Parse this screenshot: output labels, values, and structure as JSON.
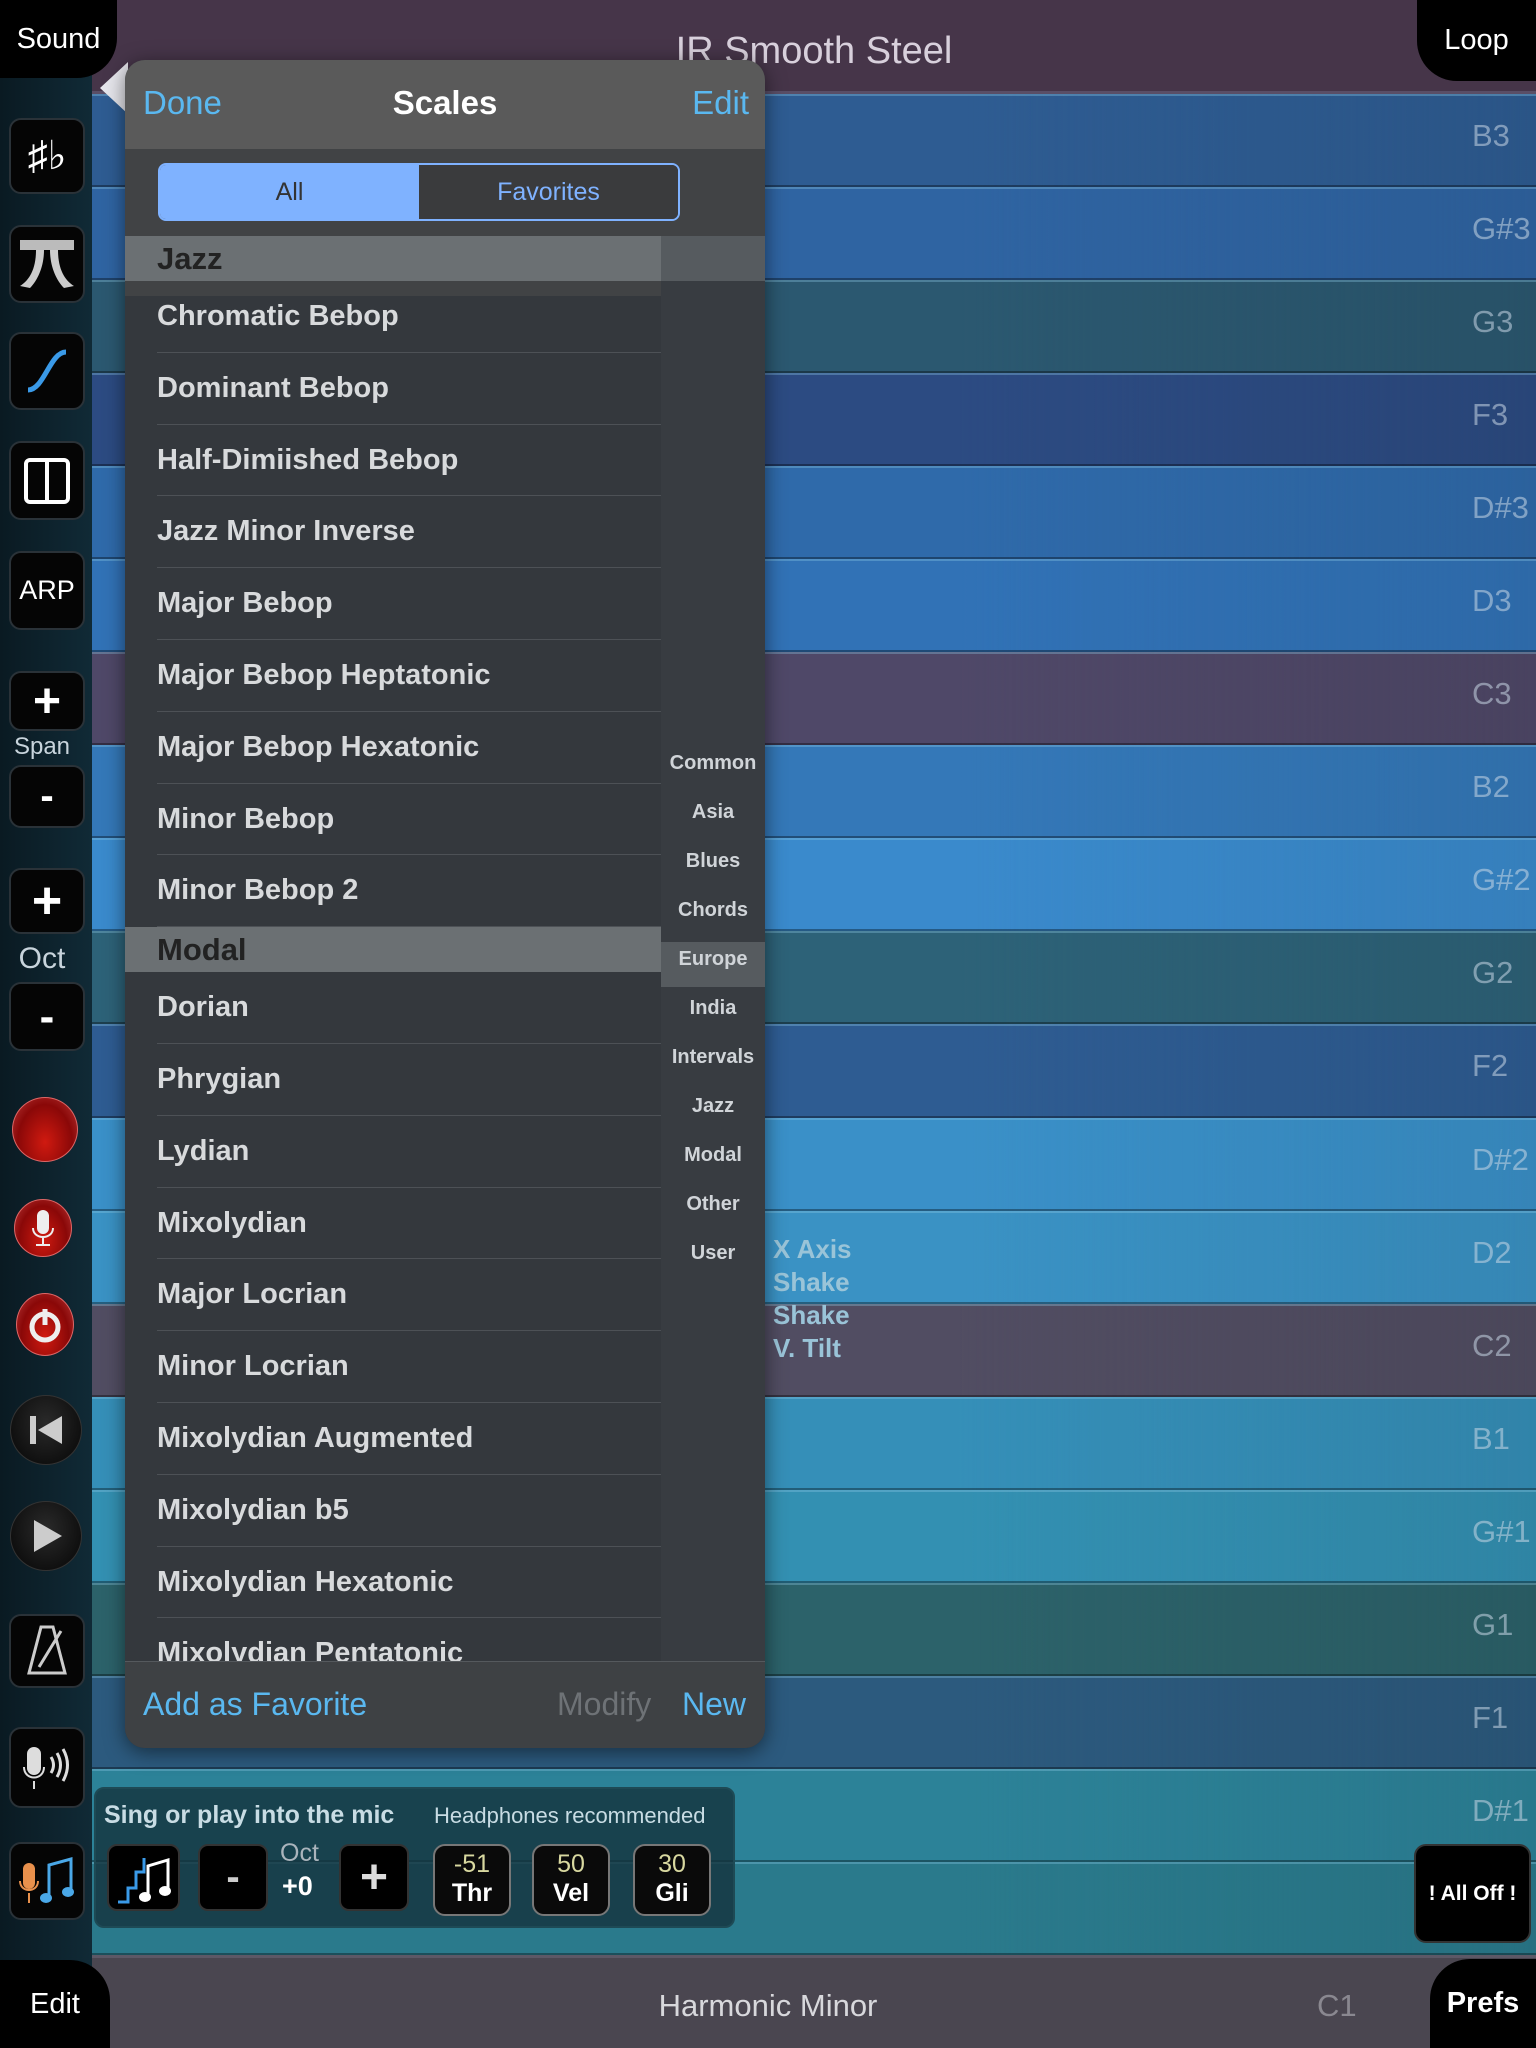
{
  "header": {
    "title": "IR Smooth Steel",
    "sound_tab": "Sound",
    "loop_tab": "Loop"
  },
  "footer": {
    "scale_name": "Harmonic Minor",
    "root_note": "C1",
    "edit_tab": "Edit",
    "prefs_tab": "Prefs"
  },
  "strips": [
    {
      "note": "B3",
      "color": "#2e5c92"
    },
    {
      "note": "G#3",
      "color": "#2f64a2"
    },
    {
      "note": "G3",
      "color": "#2b5870"
    },
    {
      "note": "F3",
      "color": "#2c4b82"
    },
    {
      "note": "D#3",
      "color": "#2f6aaa"
    },
    {
      "note": "D3",
      "color": "#3172b6"
    },
    {
      "note": "C3",
      "color": "#4f4868"
    },
    {
      "note": "B2",
      "color": "#3478b8"
    },
    {
      "note": "G#2",
      "color": "#3a8acc"
    },
    {
      "note": "G2",
      "color": "#2d6278"
    },
    {
      "note": "F2",
      "color": "#2e5c92"
    },
    {
      "note": "D#2",
      "color": "#3a90c8"
    },
    {
      "note": "D2",
      "color": "#3a92c4"
    },
    {
      "note": "C2",
      "color": "#514d62"
    },
    {
      "note": "B1",
      "color": "#358fb8"
    },
    {
      "note": "G#1",
      "color": "#3390b2"
    },
    {
      "note": "G1",
      "color": "#2c626a"
    },
    {
      "note": "F1",
      "color": "#2c5a7e"
    },
    {
      "note": "D#1",
      "color": "#2c8298"
    },
    {
      "note": "",
      "color": "#2a7a8c"
    }
  ],
  "axis_labels": [
    "X Axis",
    "Shake",
    "Shake",
    "V. Tilt"
  ],
  "sidebar": {
    "arp": "ARP",
    "span": "Span",
    "oct": "Oct",
    "plus": "+",
    "minus": "-",
    "sharp_flat": "♯♭"
  },
  "popup": {
    "done": "Done",
    "title": "Scales",
    "edit": "Edit",
    "segments": [
      "All",
      "Favorites"
    ],
    "sections": [
      {
        "name": "Jazz",
        "items": [
          "Chromatic Bebop",
          "Dominant Bebop",
          "Half-Dimiished Bebop",
          "Jazz Minor Inverse",
          "Major Bebop",
          "Major Bebop Heptatonic",
          "Major Bebop Hexatonic",
          "Minor Bebop",
          "Minor Bebop 2"
        ]
      },
      {
        "name": "Modal",
        "items": [
          "Dorian",
          "Phrygian",
          "Lydian",
          "Mixolydian",
          "Major Locrian",
          "Minor Locrian",
          "Mixolydian Augmented",
          "Mixolydian b5",
          "Mixolydian Hexatonic",
          "Mixolydian Pentatonic"
        ]
      }
    ],
    "index": [
      "Common",
      "Asia",
      "Blues",
      "Chords",
      "Europe",
      "India",
      "Intervals",
      "Jazz",
      "Modal",
      "Other",
      "User"
    ],
    "add_favorite": "Add as Favorite",
    "modify": "Modify",
    "new": "New"
  },
  "mic_panel": {
    "title": "Sing or play into the mic",
    "hint": "Headphones recommended",
    "oct_label": "Oct",
    "oct_value": "+0",
    "minus": "-",
    "plus": "+",
    "knobs": [
      {
        "value": "-51",
        "label": "Thr"
      },
      {
        "value": "50",
        "label": "Vel"
      },
      {
        "value": "30",
        "label": "Gli"
      }
    ]
  },
  "all_off": "! All Off !",
  "colors": {
    "accent": "#5ab8f0",
    "segment_selected": "#7fb2ff"
  }
}
